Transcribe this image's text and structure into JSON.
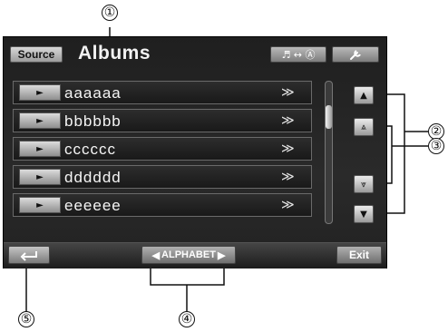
{
  "callouts": [
    "①",
    "②",
    "③",
    "④",
    "⑤"
  ],
  "header": {
    "source_label": "Source",
    "title": "Albums",
    "mode_label": "♬ ↔ Ⓐ",
    "setup_icon": "wrench-icon"
  },
  "list": {
    "play_glyph": "►",
    "more_glyph": "≫",
    "items": [
      {
        "label": "aaaaaa"
      },
      {
        "label": "bbbbbb"
      },
      {
        "label": "cccccc"
      },
      {
        "label": "dddddd"
      },
      {
        "label": "eeeeee"
      }
    ]
  },
  "scroll": {
    "position": 0.2
  },
  "nav": {
    "up_glyph": "▲",
    "page_up_glyph": "⩓",
    "page_down_glyph": "⩔",
    "down_glyph": "▼"
  },
  "bottom": {
    "back_icon": "return-arrow-icon",
    "alphabet_left": "◀",
    "alphabet_label": "ALPHABET",
    "alphabet_right": "▶",
    "exit_label": "Exit"
  }
}
